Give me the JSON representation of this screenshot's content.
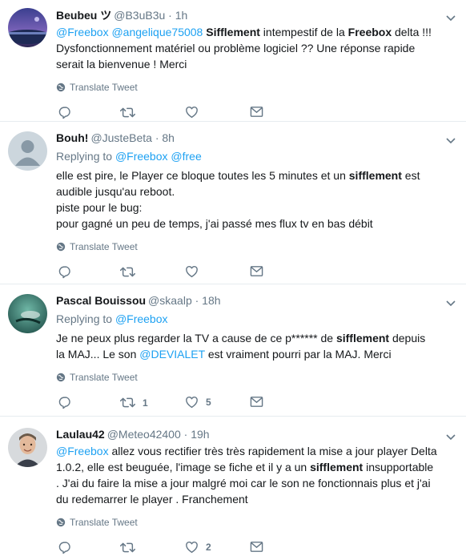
{
  "tweets": [
    {
      "name": "Beubeu ツ",
      "handle": "@B3uB3u",
      "time": "· 1h",
      "replying": "",
      "replying_links": [],
      "text_parts": [
        {
          "t": "link",
          "v": "@Freebox"
        },
        {
          "t": "plain",
          "v": " "
        },
        {
          "t": "link",
          "v": "@angelique75008"
        },
        {
          "t": "plain",
          "v": " "
        },
        {
          "t": "bold",
          "v": "Sifflement"
        },
        {
          "t": "plain",
          "v": " intempestif de la "
        },
        {
          "t": "bold",
          "v": "Freebox"
        },
        {
          "t": "plain",
          "v": " delta !!! Dysfonctionnement matériel ou problème logiciel ?? Une réponse rapide serait la bienvenue ! Merci"
        }
      ],
      "translate": "Translate Tweet",
      "retweets": "",
      "likes": ""
    },
    {
      "name": "Bouh!",
      "handle": "@JusteBeta",
      "time": "· 8h",
      "replying": "Replying to",
      "replying_links": [
        "@Freebox",
        "@free"
      ],
      "text_parts": [
        {
          "t": "plain",
          "v": "elle est pire, le Player ce bloque toutes les 5 minutes et un "
        },
        {
          "t": "bold",
          "v": "sifflement"
        },
        {
          "t": "plain",
          "v": " est audible jusqu'au reboot."
        },
        {
          "t": "br",
          "v": ""
        },
        {
          "t": "plain",
          "v": "piste pour le bug:"
        },
        {
          "t": "br",
          "v": ""
        },
        {
          "t": "plain",
          "v": "pour gagné un peu de temps, j'ai passé mes flux tv en bas débit"
        }
      ],
      "translate": "Translate Tweet",
      "retweets": "",
      "likes": ""
    },
    {
      "name": "Pascal Bouissou",
      "handle": "@skaalp",
      "time": "· 18h",
      "replying": "Replying to",
      "replying_links": [
        "@Freebox"
      ],
      "text_parts": [
        {
          "t": "plain",
          "v": "Je ne peux plus regarder la TV a cause de ce p****** de "
        },
        {
          "t": "bold",
          "v": "sifflement"
        },
        {
          "t": "plain",
          "v": " depuis la MAJ... Le son "
        },
        {
          "t": "link",
          "v": "@DEVIALET"
        },
        {
          "t": "plain",
          "v": " est vraiment pourri par la MAJ. Merci"
        }
      ],
      "translate": "Translate Tweet",
      "retweets": "1",
      "likes": "5"
    },
    {
      "name": "Laulau42",
      "handle": "@Meteo42400",
      "time": "· 19h",
      "replying": "",
      "replying_links": [],
      "text_parts": [
        {
          "t": "link",
          "v": "@Freebox"
        },
        {
          "t": "plain",
          "v": " allez vous rectifier très très rapidement la mise a jour player Delta 1.0.2, elle est beuguée, l'image se fiche et il y a un "
        },
        {
          "t": "bold",
          "v": "sifflement"
        },
        {
          "t": "plain",
          "v": " insupportable . J'ai du faire la mise a jour malgré moi car le son ne fonctionnais plus et j'ai du redemarrer le player . Franchement"
        }
      ],
      "translate": "Translate Tweet",
      "retweets": "",
      "likes": "2"
    }
  ],
  "colors": {
    "link": "#1da1f2",
    "secondary": "#657786",
    "text": "#14171a",
    "divider": "#e6ecf0"
  }
}
